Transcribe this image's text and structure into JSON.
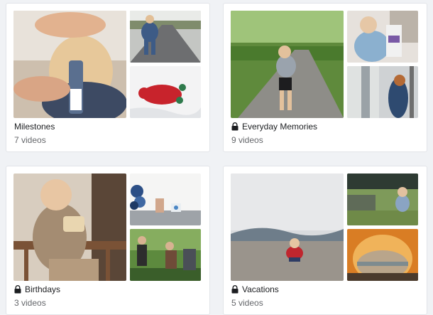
{
  "albums": [
    {
      "title": "Milestones",
      "count": "7 videos",
      "locked": false
    },
    {
      "title": "Everyday Memories",
      "count": "9 videos",
      "locked": true
    },
    {
      "title": "Birthdays",
      "count": "3 videos",
      "locked": true
    },
    {
      "title": "Vacations",
      "count": "5 videos",
      "locked": true
    }
  ],
  "colors": {
    "text": "#1c1e21",
    "subtext": "#65676b",
    "background": "#f0f2f5",
    "card": "#ffffff"
  },
  "icons": {
    "lock": "lock-icon"
  }
}
